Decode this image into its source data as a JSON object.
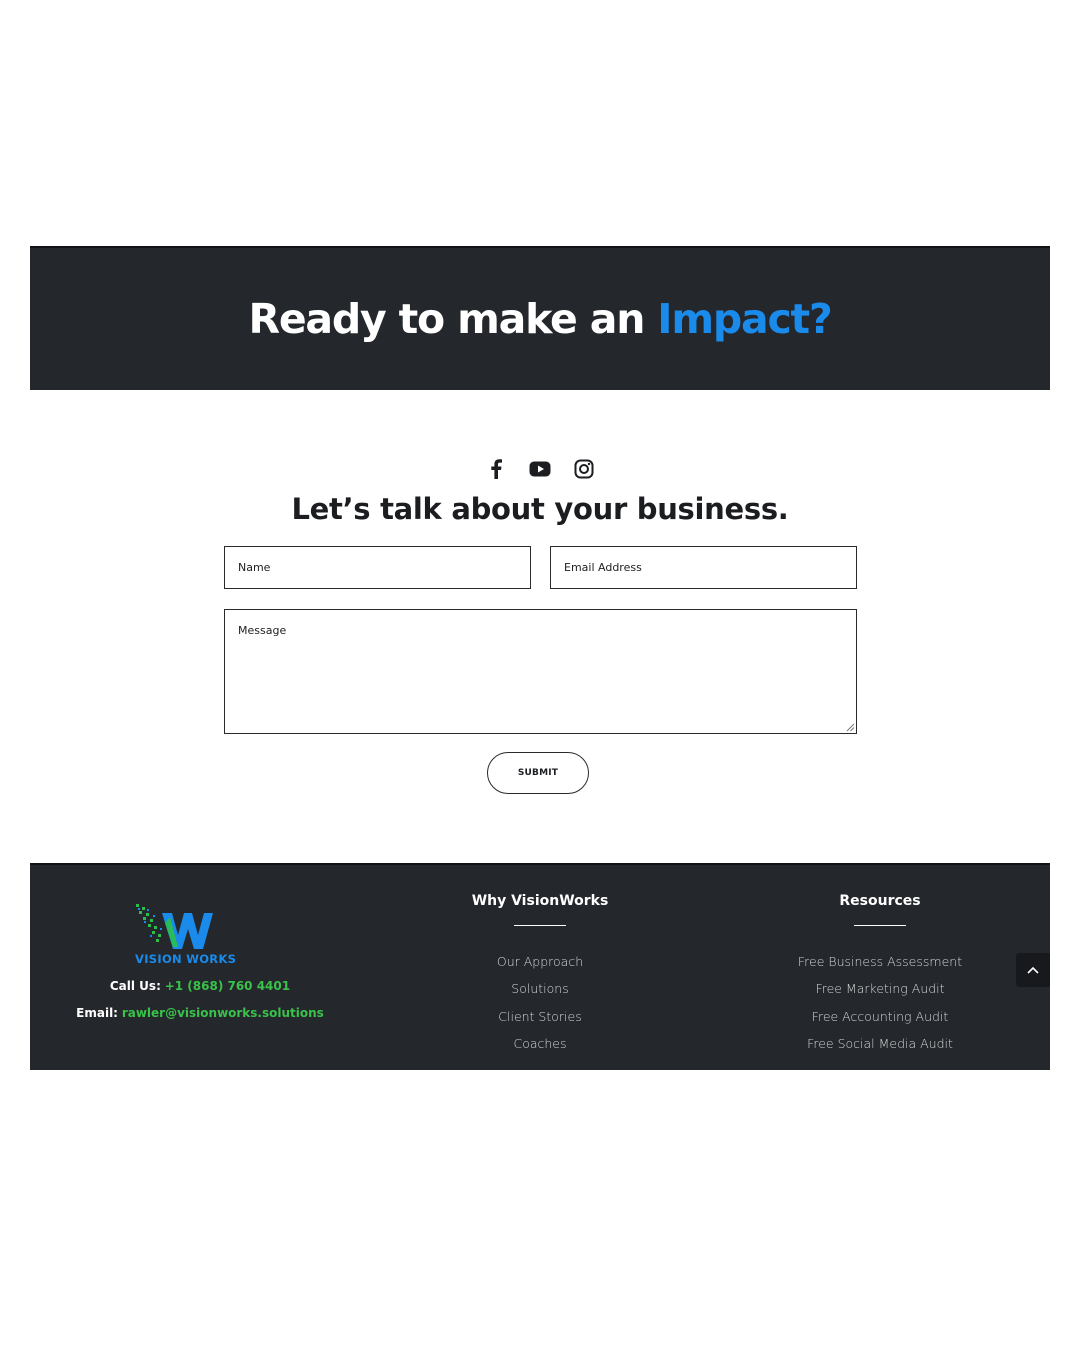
{
  "hero": {
    "title_main": "Ready to make an ",
    "title_accent": "Impact?",
    "accent_color": "#1a8bea"
  },
  "social": {
    "icons": [
      "facebook-icon",
      "youtube-icon",
      "instagram-icon"
    ]
  },
  "contact_form": {
    "heading": "Let’s talk about your business.",
    "name_placeholder": "Name",
    "email_placeholder": "Email Address",
    "message_placeholder": "Message",
    "submit_label": "SUBMIT"
  },
  "footer": {
    "logo_text": "VISION WORKS",
    "call_label": "Call Us:",
    "call_value": "+1 (868) 760 4401",
    "email_label": "Email:",
    "email_value": "rawler@visionworks.solutions",
    "link_color": "#39c14a",
    "why": {
      "title": "Why VisionWorks",
      "links": [
        "Our Approach",
        "Solutions",
        "Client Stories",
        "Coaches"
      ]
    },
    "resources": {
      "title": "Resources",
      "links": [
        "Free Business Assessment",
        "Free Marketing Audit",
        "Free Accounting Audit",
        "Free Social Media Audit"
      ]
    }
  },
  "back_to_top_icon": "chevron-up-icon"
}
